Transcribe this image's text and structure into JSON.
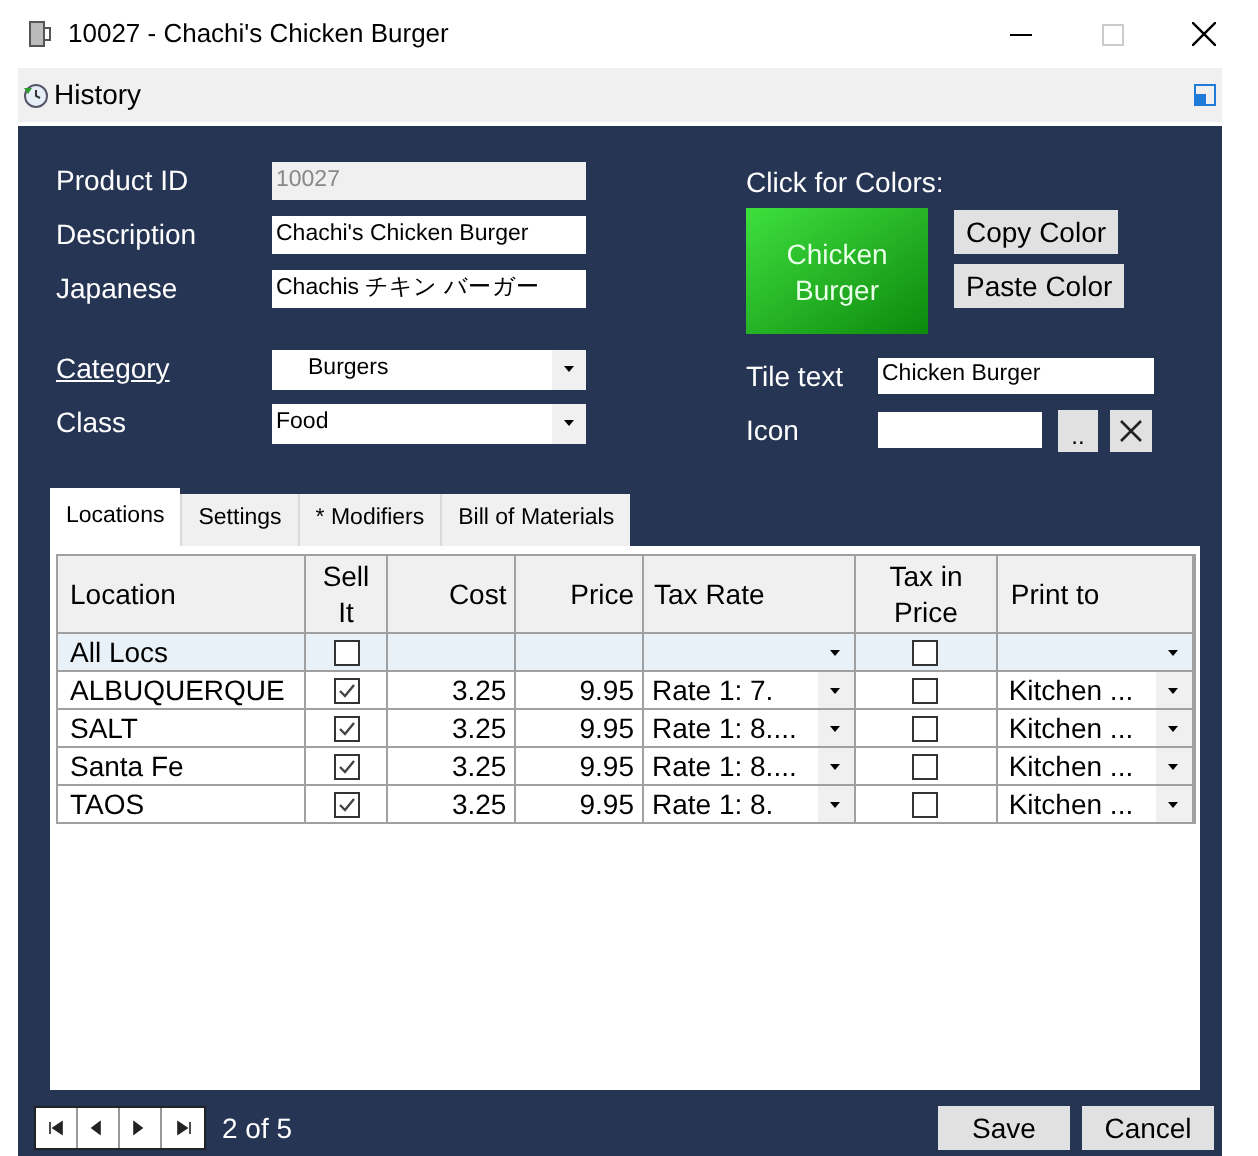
{
  "window": {
    "title": "10027 - Chachi's Chicken Burger"
  },
  "toolbar": {
    "history_label": "History"
  },
  "form": {
    "product_id": {
      "label": "Product ID",
      "value": "10027",
      "disabled": true
    },
    "description": {
      "label": "Description",
      "value": "Chachi's Chicken Burger"
    },
    "japanese": {
      "label": "Japanese",
      "value": "Chachis チキン バーガー"
    },
    "category": {
      "label": "Category",
      "value": "Burgers"
    },
    "class": {
      "label": "Class",
      "value": "Food"
    }
  },
  "colors": {
    "label": "Click for Colors:",
    "tile_preview": "Chicken Burger",
    "copy_button": "Copy Color",
    "paste_button": "Paste Color",
    "tile_text": {
      "label": "Tile text",
      "value": "Chicken Burger"
    },
    "icon": {
      "label": "Icon",
      "browse_button": ".."
    }
  },
  "tabs": [
    {
      "label": "Locations",
      "selected": true
    },
    {
      "label": "Settings",
      "selected": false
    },
    {
      "label": "* Modifiers",
      "selected": false
    },
    {
      "label": "Bill of Materials",
      "selected": false
    }
  ],
  "table": {
    "columns": [
      "Location",
      "Sell It",
      "Cost",
      "Price",
      "Tax Rate",
      "Tax in Price",
      "Print to"
    ],
    "rows": [
      {
        "location": "All Locs",
        "sell_it": false,
        "cost": "",
        "price": "",
        "tax_rate": "",
        "tax_in_price": false,
        "print_to": "",
        "selected": true
      },
      {
        "location": "ALBUQUERQUE",
        "sell_it": true,
        "cost": "3.25",
        "price": "9.95",
        "tax_rate": "Rate 1:  7.",
        "tax_in_price": false,
        "print_to": "Kitchen ...",
        "selected": false
      },
      {
        "location": "SALT",
        "sell_it": true,
        "cost": "3.25",
        "price": "9.95",
        "tax_rate": "Rate 1:  8....",
        "tax_in_price": false,
        "print_to": "Kitchen ...",
        "selected": false
      },
      {
        "location": "Santa Fe",
        "sell_it": true,
        "cost": "3.25",
        "price": "9.95",
        "tax_rate": "Rate 1:  8....",
        "tax_in_price": false,
        "print_to": "Kitchen ...",
        "selected": false
      },
      {
        "location": "TAOS",
        "sell_it": true,
        "cost": "3.25",
        "price": "9.95",
        "tax_rate": "Rate 1:  8.",
        "tax_in_price": false,
        "print_to": "Kitchen ...",
        "selected": false
      }
    ]
  },
  "navigator": {
    "position": "2 of 5"
  },
  "buttons": {
    "save": "Save",
    "cancel": "Cancel"
  }
}
